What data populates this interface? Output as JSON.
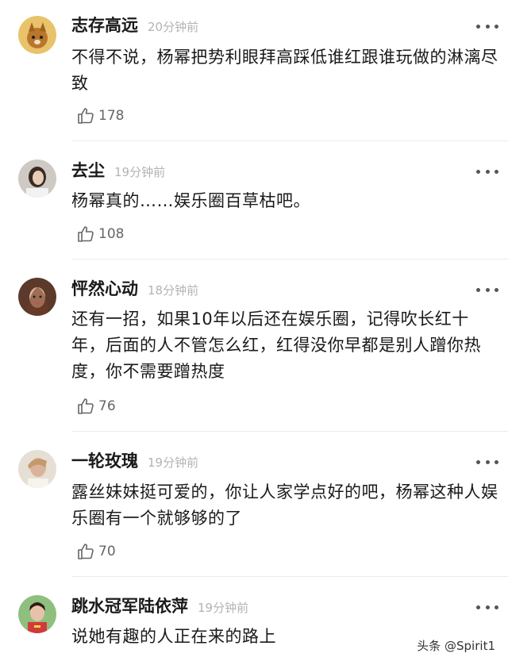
{
  "comments": [
    {
      "user": "志存高远",
      "time": "20分钟前",
      "text": "不得不说，杨幂把势利眼拜高踩低谁红跟谁玩做的淋漓尽致",
      "likes": "178"
    },
    {
      "user": "去尘",
      "time": "19分钟前",
      "text": "杨幂真的……娱乐圈百草枯吧。",
      "likes": "108"
    },
    {
      "user": "怦然心动",
      "time": "18分钟前",
      "text": "还有一招，如果10年以后还在娱乐圈，记得吹长红十年，后面的人不管怎么红，红得没你早都是别人蹭你热度，你不需要蹭热度",
      "likes": "76"
    },
    {
      "user": "一轮玫瑰",
      "time": "19分钟前",
      "text": "露丝妹妹挺可爱的，你让人家学点好的吧，杨幂这种人娱乐圈有一个就够够的了",
      "likes": "70"
    },
    {
      "user": "跳水冠军陆依萍",
      "time": "19分钟前",
      "text": "说她有趣的人正在来的路上",
      "likes": ""
    }
  ],
  "watermark": "头条 @Spirit1",
  "icons": {
    "like": "thumbs-up-icon",
    "more": "more-dots-icon"
  }
}
